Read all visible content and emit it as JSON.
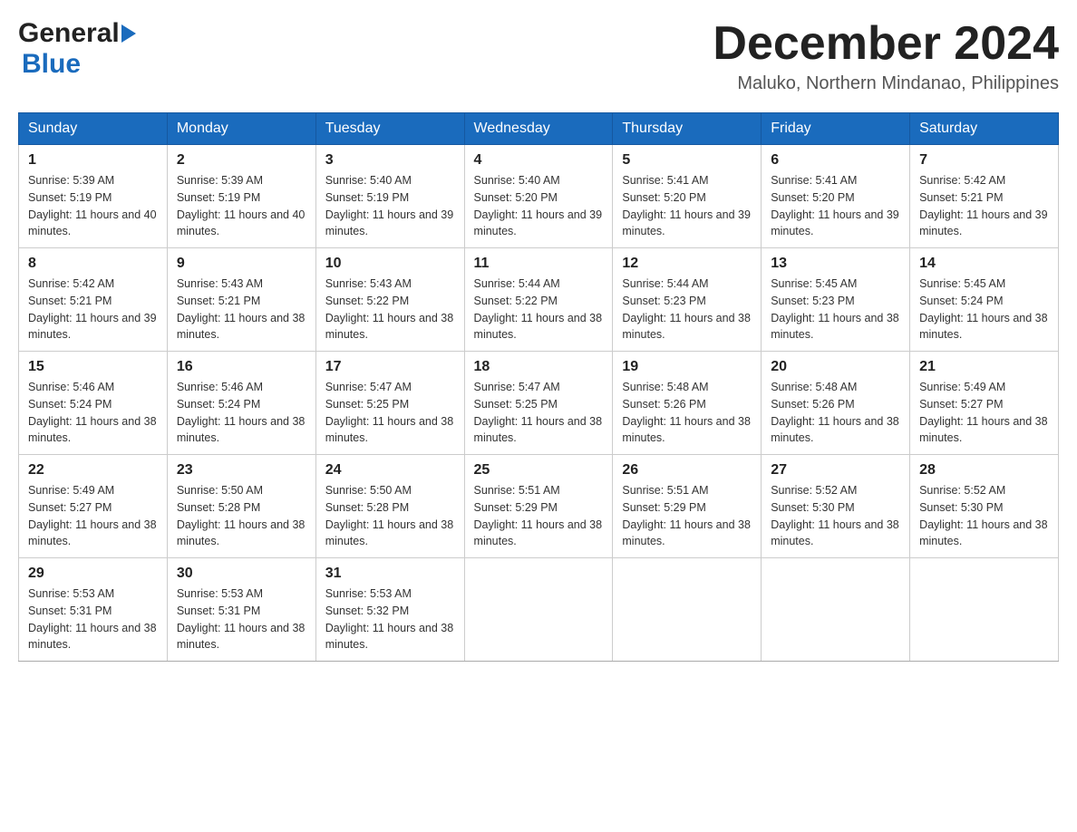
{
  "header": {
    "logo_general": "General",
    "logo_blue": "Blue",
    "title": "December 2024",
    "subtitle": "Maluko, Northern Mindanao, Philippines"
  },
  "days_of_week": [
    "Sunday",
    "Monday",
    "Tuesday",
    "Wednesday",
    "Thursday",
    "Friday",
    "Saturday"
  ],
  "weeks": [
    [
      {
        "day": "1",
        "sunrise": "5:39 AM",
        "sunset": "5:19 PM",
        "daylight": "11 hours and 40 minutes."
      },
      {
        "day": "2",
        "sunrise": "5:39 AM",
        "sunset": "5:19 PM",
        "daylight": "11 hours and 40 minutes."
      },
      {
        "day": "3",
        "sunrise": "5:40 AM",
        "sunset": "5:19 PM",
        "daylight": "11 hours and 39 minutes."
      },
      {
        "day": "4",
        "sunrise": "5:40 AM",
        "sunset": "5:20 PM",
        "daylight": "11 hours and 39 minutes."
      },
      {
        "day": "5",
        "sunrise": "5:41 AM",
        "sunset": "5:20 PM",
        "daylight": "11 hours and 39 minutes."
      },
      {
        "day": "6",
        "sunrise": "5:41 AM",
        "sunset": "5:20 PM",
        "daylight": "11 hours and 39 minutes."
      },
      {
        "day": "7",
        "sunrise": "5:42 AM",
        "sunset": "5:21 PM",
        "daylight": "11 hours and 39 minutes."
      }
    ],
    [
      {
        "day": "8",
        "sunrise": "5:42 AM",
        "sunset": "5:21 PM",
        "daylight": "11 hours and 39 minutes."
      },
      {
        "day": "9",
        "sunrise": "5:43 AM",
        "sunset": "5:21 PM",
        "daylight": "11 hours and 38 minutes."
      },
      {
        "day": "10",
        "sunrise": "5:43 AM",
        "sunset": "5:22 PM",
        "daylight": "11 hours and 38 minutes."
      },
      {
        "day": "11",
        "sunrise": "5:44 AM",
        "sunset": "5:22 PM",
        "daylight": "11 hours and 38 minutes."
      },
      {
        "day": "12",
        "sunrise": "5:44 AM",
        "sunset": "5:23 PM",
        "daylight": "11 hours and 38 minutes."
      },
      {
        "day": "13",
        "sunrise": "5:45 AM",
        "sunset": "5:23 PM",
        "daylight": "11 hours and 38 minutes."
      },
      {
        "day": "14",
        "sunrise": "5:45 AM",
        "sunset": "5:24 PM",
        "daylight": "11 hours and 38 minutes."
      }
    ],
    [
      {
        "day": "15",
        "sunrise": "5:46 AM",
        "sunset": "5:24 PM",
        "daylight": "11 hours and 38 minutes."
      },
      {
        "day": "16",
        "sunrise": "5:46 AM",
        "sunset": "5:24 PM",
        "daylight": "11 hours and 38 minutes."
      },
      {
        "day": "17",
        "sunrise": "5:47 AM",
        "sunset": "5:25 PM",
        "daylight": "11 hours and 38 minutes."
      },
      {
        "day": "18",
        "sunrise": "5:47 AM",
        "sunset": "5:25 PM",
        "daylight": "11 hours and 38 minutes."
      },
      {
        "day": "19",
        "sunrise": "5:48 AM",
        "sunset": "5:26 PM",
        "daylight": "11 hours and 38 minutes."
      },
      {
        "day": "20",
        "sunrise": "5:48 AM",
        "sunset": "5:26 PM",
        "daylight": "11 hours and 38 minutes."
      },
      {
        "day": "21",
        "sunrise": "5:49 AM",
        "sunset": "5:27 PM",
        "daylight": "11 hours and 38 minutes."
      }
    ],
    [
      {
        "day": "22",
        "sunrise": "5:49 AM",
        "sunset": "5:27 PM",
        "daylight": "11 hours and 38 minutes."
      },
      {
        "day": "23",
        "sunrise": "5:50 AM",
        "sunset": "5:28 PM",
        "daylight": "11 hours and 38 minutes."
      },
      {
        "day": "24",
        "sunrise": "5:50 AM",
        "sunset": "5:28 PM",
        "daylight": "11 hours and 38 minutes."
      },
      {
        "day": "25",
        "sunrise": "5:51 AM",
        "sunset": "5:29 PM",
        "daylight": "11 hours and 38 minutes."
      },
      {
        "day": "26",
        "sunrise": "5:51 AM",
        "sunset": "5:29 PM",
        "daylight": "11 hours and 38 minutes."
      },
      {
        "day": "27",
        "sunrise": "5:52 AM",
        "sunset": "5:30 PM",
        "daylight": "11 hours and 38 minutes."
      },
      {
        "day": "28",
        "sunrise": "5:52 AM",
        "sunset": "5:30 PM",
        "daylight": "11 hours and 38 minutes."
      }
    ],
    [
      {
        "day": "29",
        "sunrise": "5:53 AM",
        "sunset": "5:31 PM",
        "daylight": "11 hours and 38 minutes."
      },
      {
        "day": "30",
        "sunrise": "5:53 AM",
        "sunset": "5:31 PM",
        "daylight": "11 hours and 38 minutes."
      },
      {
        "day": "31",
        "sunrise": "5:53 AM",
        "sunset": "5:32 PM",
        "daylight": "11 hours and 38 minutes."
      },
      null,
      null,
      null,
      null
    ]
  ],
  "labels": {
    "sunrise": "Sunrise:",
    "sunset": "Sunset:",
    "daylight": "Daylight:"
  }
}
